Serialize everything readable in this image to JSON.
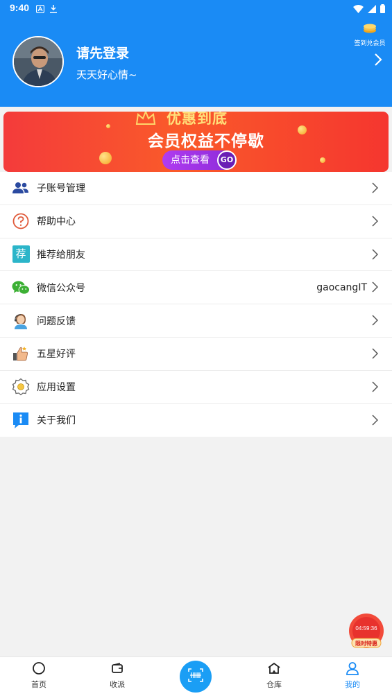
{
  "status_bar": {
    "time": "9:40"
  },
  "profile": {
    "title": "请先登录",
    "motto": "天天好心情~",
    "signin_label": "签到兑会员"
  },
  "banner": {
    "top_text": "优惠到底",
    "main_text": "会员权益不停歇",
    "button_label": "点击查看",
    "go_label": "GO"
  },
  "menu": {
    "items": [
      {
        "label": "子账号管理",
        "icon": "sub-account-icon",
        "value": ""
      },
      {
        "label": "帮助中心",
        "icon": "help-icon",
        "value": ""
      },
      {
        "label": "推荐给朋友",
        "icon": "recommend-icon",
        "icon_text": "荐",
        "value": ""
      },
      {
        "label": "微信公众号",
        "icon": "wechat-icon",
        "value": "gaocangIT"
      },
      {
        "label": "问题反馈",
        "icon": "feedback-icon",
        "value": ""
      },
      {
        "label": "五星好评",
        "icon": "thumbs-up-icon",
        "value": ""
      },
      {
        "label": "应用设置",
        "icon": "settings-icon",
        "value": ""
      },
      {
        "label": "关于我们",
        "icon": "info-icon",
        "value": ""
      }
    ]
  },
  "promo": {
    "timer": "04:59:36",
    "label": "限时特惠"
  },
  "bottom_nav": {
    "items": [
      {
        "label": "首页",
        "icon": "home-circle-icon"
      },
      {
        "label": "收派",
        "icon": "wallet-icon"
      },
      {
        "label": "",
        "icon": "scan-icon"
      },
      {
        "label": "仓库",
        "icon": "warehouse-icon"
      },
      {
        "label": "我的",
        "icon": "profile-icon",
        "active": true
      }
    ]
  },
  "colors": {
    "primary": "#1a8bf5",
    "banner_red": "#f43b3b",
    "promo_red": "#e8322d"
  }
}
